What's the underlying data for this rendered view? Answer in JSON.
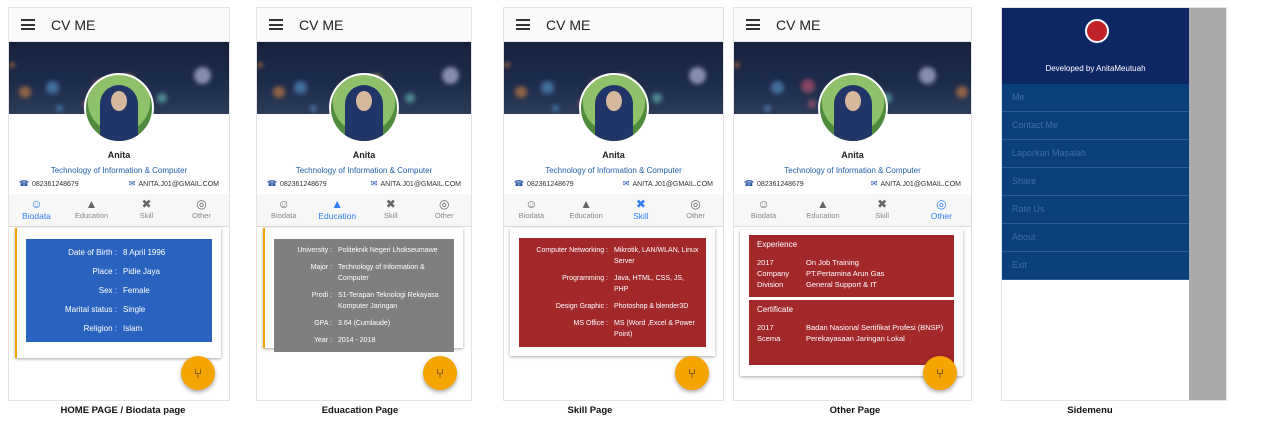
{
  "app_title": "CV ME",
  "profile": {
    "name": "Anita",
    "desc": "Technology of Information & Computer",
    "phone": "082361248679",
    "email": "ANITA.J01@GMAIL.COM"
  },
  "tabs": [
    "Biodata",
    "Education",
    "Skill",
    "Other"
  ],
  "biodata": [
    {
      "k": "Date of Birth :",
      "v": "8 April 1996"
    },
    {
      "k": "Place :",
      "v": "Pidie Jaya"
    },
    {
      "k": "Sex :",
      "v": "Female"
    },
    {
      "k": "Marital status :",
      "v": "Single"
    },
    {
      "k": "Religion :",
      "v": "Islam"
    }
  ],
  "education": [
    {
      "k": "University :",
      "v": "Politeknik Negeri Lhokseumawe"
    },
    {
      "k": "Major :",
      "v": "Technology of Information & Computer"
    },
    {
      "k": "Prodi :",
      "v": "S1-Terapan Teknologi Rekayasa Komputer Jaringan"
    },
    {
      "k": "GPA :",
      "v": "3.64 (Cumlaude)"
    },
    {
      "k": "Year :",
      "v": "2014 - 2018"
    }
  ],
  "skills": [
    {
      "k": "Computer Networking :",
      "v": "Mikrotik, LAN/WLAN, Linux Server"
    },
    {
      "k": "Programming :",
      "v": "Java, HTML, CSS, JS, PHP"
    },
    {
      "k": "Design Graphic :",
      "v": "Photoshop & blender3D"
    },
    {
      "k": "MS Office :",
      "v": "MS (Word ,Excel & Power Point)"
    }
  ],
  "other": {
    "experience_title": "Experience",
    "experience": [
      {
        "k": "2017",
        "v": "On Job Training"
      },
      {
        "k": "Company",
        "v": "PT.Pertamina Arun Gas"
      },
      {
        "k": "Division",
        "v": "General Support & IT"
      }
    ],
    "certificate_title": "Certificate",
    "certificate": [
      {
        "k": "2017",
        "v": "Badan Nasional Sertifikat Profesi (BNSP)"
      },
      {
        "k": "Scema",
        "v": "Perekayasaan Jaringan Lokal"
      }
    ]
  },
  "side_menu": {
    "caption": "Developed by AnitaMeutuah",
    "items": [
      "Me",
      "Contact Me",
      "Laporkan Masalah",
      "Share",
      "Rate Us",
      "About",
      "Exit"
    ]
  },
  "captions": [
    "HOME PAGE / Biodata page",
    "Eduacation Page",
    "Skill Page",
    "Other Page",
    "Sidemenu"
  ],
  "colors": {
    "biodata_card": "#2a62bf",
    "education_card": "#7f7f7f",
    "skill_card": "#a2282a",
    "other_card": "#a2282a",
    "fab": "#f5a400",
    "active_tab": "#2f7ff0",
    "drawer_head": "#0d2765",
    "drawer_list": "#0b3f7b"
  }
}
